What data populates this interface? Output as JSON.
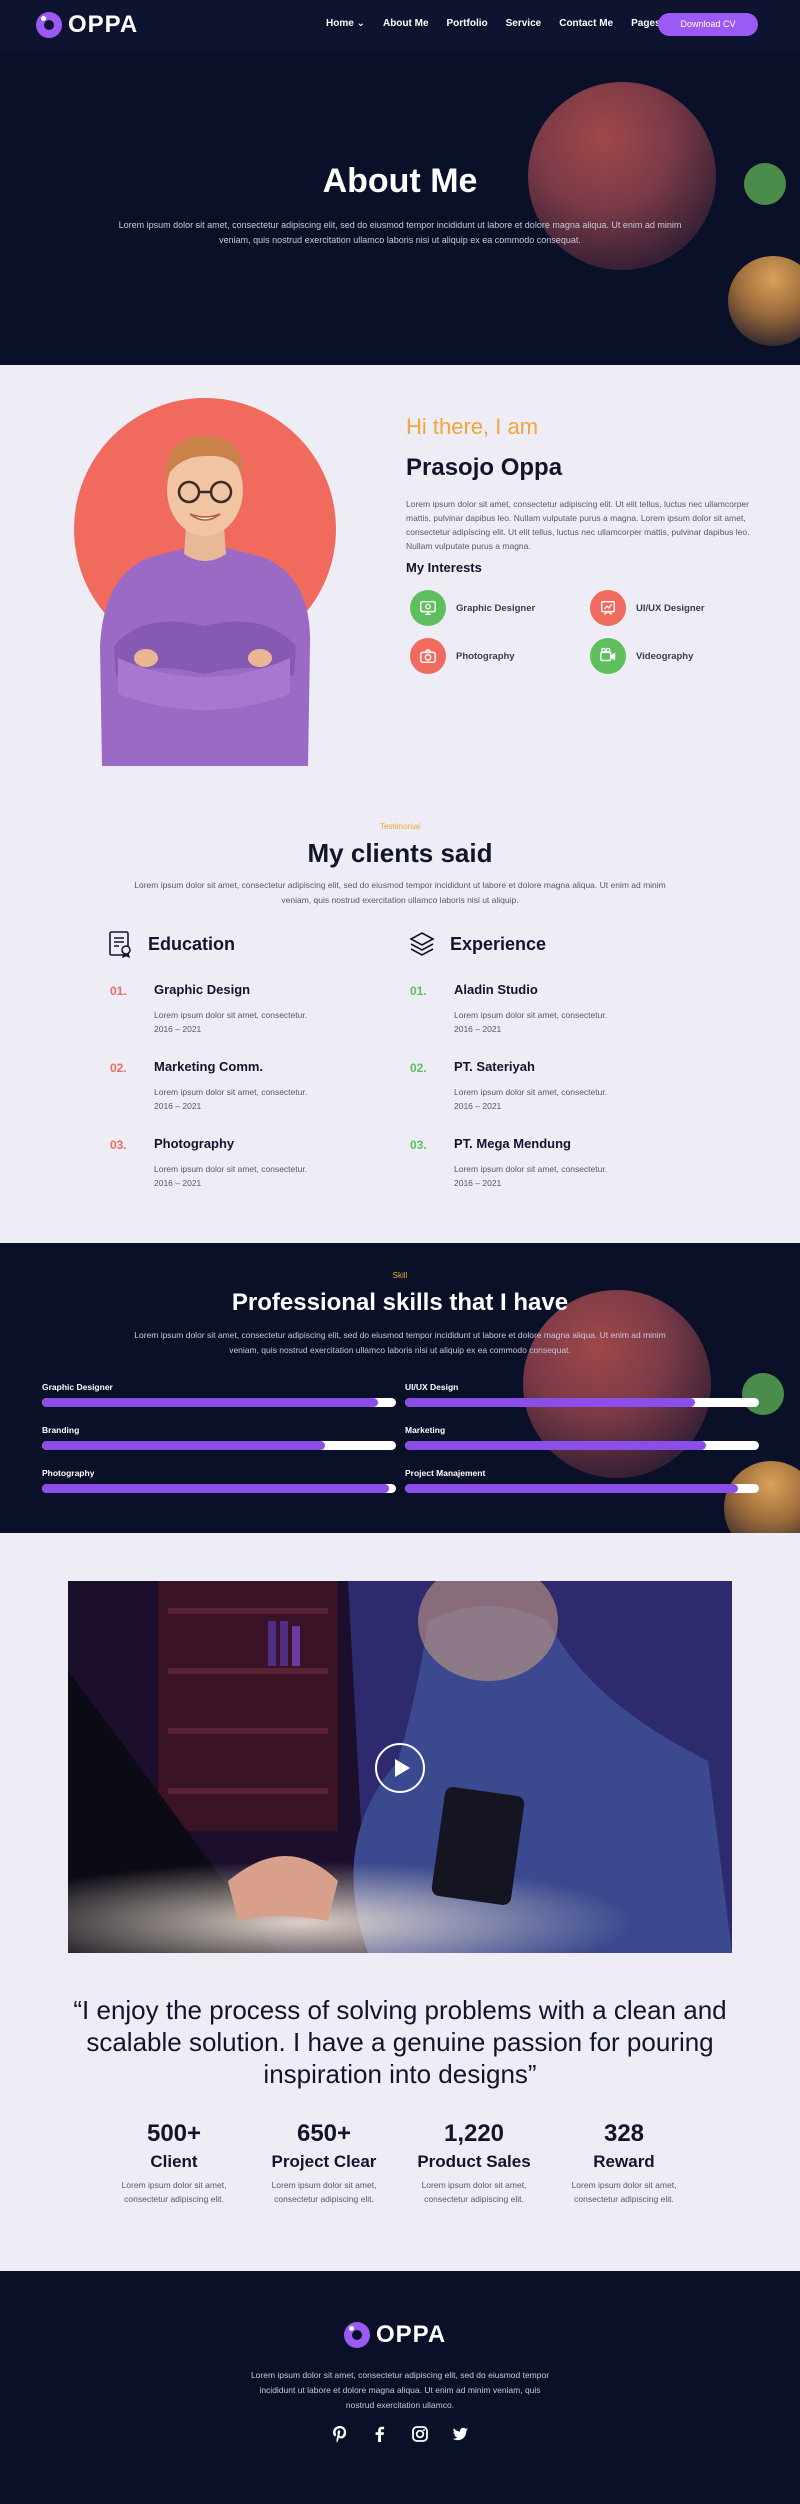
{
  "nav": {
    "logo": "OPPA",
    "items": [
      "Home",
      "About Me",
      "Portfolio",
      "Service",
      "Contact Me",
      "Pages"
    ],
    "cta": "Download CV"
  },
  "hero": {
    "title": "About Me",
    "text": "Lorem ipsum dolor sit amet, consectetur adipiscing elit, sed do eiusmod tempor incididunt ut labore et dolore magna aliqua. Ut enim ad minim veniam, quis nostrud exercitation ullamco laboris nisi ut aliquip ex ea commodo consequat."
  },
  "about": {
    "greeting": "Hi there, I am",
    "name": "Prasojo Oppa",
    "text": "Lorem ipsum dolor sit amet, consectetur adipiscing elit. Ut elit tellus, luctus nec ullamcorper mattis, pulvinar dapibus leo. Nullam vulputate purus a magna. Lorem ipsum dolor sit amet, consectetur adipiscing elit. Ut elit tellus, luctus nec ullamcorper mattis, pulvinar dapibus leo. Nullam vulputate purus a magna.",
    "interests_title": "My Interests",
    "interests": [
      "Graphic Designer",
      "UI/UX Designer",
      "Photography",
      "Videography"
    ]
  },
  "clients": {
    "tag": "Testimonial",
    "title": "My clients said",
    "text": "Lorem ipsum dolor sit amet, consectetur adipiscing elit, sed do eiusmod tempor incididunt ut labore et dolore magna aliqua. Ut enim ad minim veniam, quis nostrud exercitation ullamco laboris nisi ut aliquip.",
    "education_title": "Education",
    "experience_title": "Experience",
    "education": [
      {
        "num": "01.",
        "title": "Graphic Design",
        "desc": "Lorem ipsum dolor sit amet, consectetur.",
        "years": "2016 – 2021"
      },
      {
        "num": "02.",
        "title": "Marketing Comm.",
        "desc": "Lorem ipsum dolor sit amet, consectetur.",
        "years": "2016 – 2021"
      },
      {
        "num": "03.",
        "title": "Photography",
        "desc": "Lorem ipsum dolor sit amet, consectetur.",
        "years": "2016 – 2021"
      }
    ],
    "experience": [
      {
        "num": "01.",
        "title": "Aladin Studio",
        "desc": "Lorem ipsum dolor sit amet, consectetur.",
        "years": "2016 – 2021"
      },
      {
        "num": "02.",
        "title": "PT. Sateriyah",
        "desc": "Lorem ipsum dolor sit amet, consectetur.",
        "years": "2016 – 2021"
      },
      {
        "num": "03.",
        "title": "PT. Mega Mendung",
        "desc": "Lorem ipsum dolor sit amet, consectetur.",
        "years": "2016 – 2021"
      }
    ]
  },
  "skills": {
    "tag": "Skill",
    "title": "Professional skills that I have",
    "text": "Lorem ipsum dolor sit amet, consectetur adipiscing elit, sed do eiusmod tempor incididunt ut labore et dolore magna aliqua. Ut enim ad minim veniam, quis nostrud exercitation ullamco laboris nisi ut aliquip ex ea commodo consequat.",
    "items": [
      {
        "name": "Graphic Designer",
        "level": 0.95
      },
      {
        "name": "UI/UX Design",
        "level": 0.82
      },
      {
        "name": "Branding",
        "level": 0.8
      },
      {
        "name": "Marketing",
        "level": 0.85
      },
      {
        "name": "Photography",
        "level": 0.98
      },
      {
        "name": "Project Manajement",
        "level": 0.94
      }
    ]
  },
  "quote": "“I enjoy the process of solving problems with a clean and scalable solution. I have a genuine passion for pouring inspiration into designs”",
  "stats": [
    {
      "value": "500+",
      "label": "Client",
      "desc": "Lorem ipsum dolor sit amet, consectetur adipiscing elit."
    },
    {
      "value": "650+",
      "label": "Project Clear",
      "desc": "Lorem ipsum dolor sit amet, consectetur adipiscing elit."
    },
    {
      "value": "1,220",
      "label": "Product Sales",
      "desc": "Lorem ipsum dolor sit amet, consectetur adipiscing elit."
    },
    {
      "value": "328",
      "label": "Reward",
      "desc": "Lorem ipsum dolor sit amet, consectetur adipiscing elit."
    }
  ],
  "footer": {
    "logo": "OPPA",
    "text": "Lorem ipsum dolor sit amet, consectetur adipiscing elit, sed do eiusmod tempor incididunt ut labore et dolore magna aliqua. Ut enim ad minim veniam, quis nostrud exercitation ullamco.",
    "socials": [
      "pinterest-icon",
      "facebook-icon",
      "instagram-icon",
      "twitter-icon"
    ]
  },
  "colors": {
    "navy": "#0b1029",
    "purple": "#9b59f5",
    "orange": "#f4a43a",
    "coral": "#f06a5e",
    "green": "#5fbf5f"
  }
}
